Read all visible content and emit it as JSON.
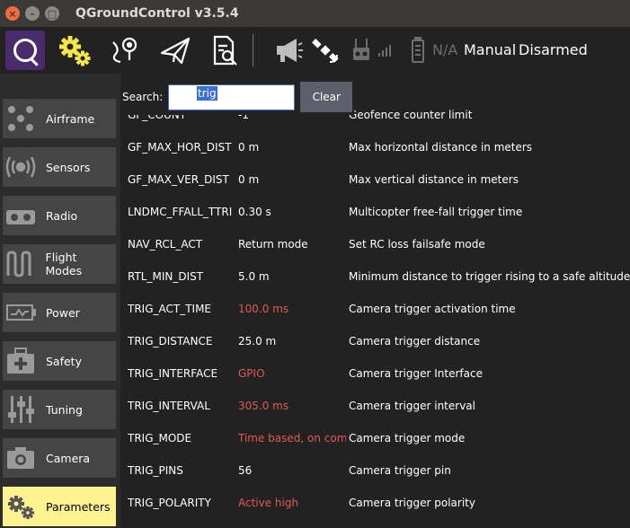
{
  "window": {
    "title": "QGroundControl v3.5.4"
  },
  "toolbar": {
    "icons": [
      "qgc-logo-icon",
      "settings-gears-icon",
      "plan-waypoint-icon",
      "fly-paper-plane-icon",
      "analyze-document-icon",
      "megaphone-icon",
      "gps-satellite-icon",
      "rc-transmitter-icon",
      "battery-icon"
    ],
    "battery_text": "N/A",
    "flight_mode": "Manual",
    "arm_status": "Disarmed"
  },
  "sidebar": {
    "items": [
      {
        "label": "Airframe",
        "icon": "airframe-icon"
      },
      {
        "label": "Sensors",
        "icon": "sensors-icon"
      },
      {
        "label": "Radio",
        "icon": "radio-icon"
      },
      {
        "label": "Flight Modes",
        "icon": "flight-modes-icon"
      },
      {
        "label": "Power",
        "icon": "power-icon"
      },
      {
        "label": "Safety",
        "icon": "safety-icon"
      },
      {
        "label": "Tuning",
        "icon": "tuning-icon"
      },
      {
        "label": "Camera",
        "icon": "camera-icon"
      },
      {
        "label": "Parameters",
        "icon": "parameters-icon"
      }
    ]
  },
  "search": {
    "label": "Search:",
    "value": "trig",
    "clear_label": "Clear"
  },
  "params": [
    {
      "name": "GF_COUNT",
      "value": "-1",
      "desc": "Geofence counter limit",
      "modified": false
    },
    {
      "name": "GF_MAX_HOR_DIST",
      "value": "0 m",
      "desc": "Max horizontal distance in meters",
      "modified": false
    },
    {
      "name": "GF_MAX_VER_DIST",
      "value": "0 m",
      "desc": "Max vertical distance in meters",
      "modified": false
    },
    {
      "name": "LNDMC_FFALL_TTRI",
      "value": "0.30 s",
      "desc": "Multicopter free-fall trigger time",
      "modified": false
    },
    {
      "name": "NAV_RCL_ACT",
      "value": "Return mode",
      "desc": "Set RC loss failsafe mode",
      "modified": false
    },
    {
      "name": "RTL_MIN_DIST",
      "value": "5.0 m",
      "desc": "Minimum distance to trigger rising to a safe altitude",
      "modified": false
    },
    {
      "name": "TRIG_ACT_TIME",
      "value": "100.0 ms",
      "desc": "Camera trigger activation time",
      "modified": true
    },
    {
      "name": "TRIG_DISTANCE",
      "value": "25.0 m",
      "desc": "Camera trigger distance",
      "modified": false
    },
    {
      "name": "TRIG_INTERFACE",
      "value": "GPIO",
      "desc": "Camera trigger Interface",
      "modified": true
    },
    {
      "name": "TRIG_INTERVAL",
      "value": "305.0 ms",
      "desc": "Camera trigger interval",
      "modified": true
    },
    {
      "name": "TRIG_MODE",
      "value": "Time based, on command",
      "desc": "Camera trigger mode",
      "modified": true
    },
    {
      "name": "TRIG_PINS",
      "value": "56",
      "desc": "Camera trigger pin",
      "modified": false
    },
    {
      "name": "TRIG_POLARITY",
      "value": "Active high",
      "desc": "Camera trigger polarity",
      "modified": true
    }
  ],
  "colors": {
    "accent_yellow": "#fff391",
    "modified_value": "#e25a4f",
    "logo_purple": "#4a2c6d",
    "close_button": "#f36a3c"
  }
}
